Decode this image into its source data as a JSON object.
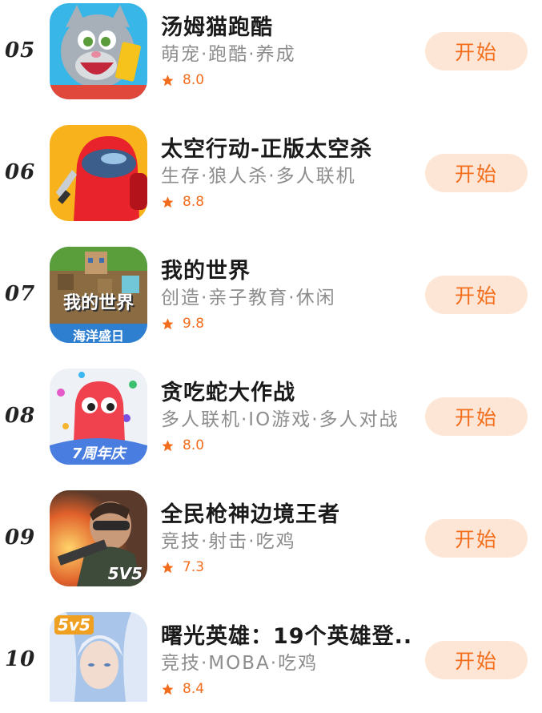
{
  "accent_color": "#f36c1b",
  "button_bg": "#fee6d6",
  "games": [
    {
      "rank": "05",
      "title": "汤姆猫跑酷",
      "tags": "萌宠·跑酷·养成",
      "rating": "8.0",
      "button": "开始",
      "icon": "talking-tom-icon"
    },
    {
      "rank": "06",
      "title": "太空行动-正版太空杀",
      "tags": "生存·狼人杀·多人联机",
      "rating": "8.8",
      "button": "开始",
      "icon": "red-crewmate-icon"
    },
    {
      "rank": "07",
      "title": "我的世界",
      "tags": "创造·亲子教育·休闲",
      "rating": "9.8",
      "button": "开始",
      "icon": "minecraft-icon",
      "icon_text": "我的世界",
      "icon_banner": "海洋盛日"
    },
    {
      "rank": "08",
      "title": "贪吃蛇大作战",
      "tags": "多人联机·IO游戏·多人对战",
      "rating": "8.0",
      "button": "开始",
      "icon": "snake-icon",
      "icon_banner": "7周年庆"
    },
    {
      "rank": "09",
      "title": "全民枪神边境王者",
      "tags": "竞技·射击·吃鸡",
      "rating": "7.3",
      "button": "开始",
      "icon": "soldier-icon",
      "icon_badge": "5V5"
    },
    {
      "rank": "10",
      "title": "曙光英雄：19个英雄登..",
      "tags": "竞技·MOBA·吃鸡",
      "rating": "8.4",
      "button": "开始",
      "icon": "hero-icon",
      "icon_badge": "5v5"
    }
  ]
}
